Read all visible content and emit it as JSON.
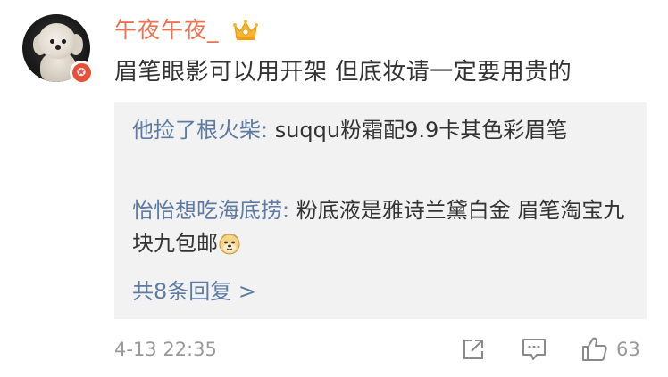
{
  "comment": {
    "username": "午夜午夜_",
    "text": "眉笔眼影可以用开架 但底妆请一定要用贵的",
    "vip_badge_glyph": "✪",
    "timestamp": "4-13 22:35",
    "like_count": "63"
  },
  "replies": [
    {
      "author": "他捡了根火柴",
      "separator": ": ",
      "text": "suqqu粉霜配9.9卡其色彩眉笔"
    },
    {
      "author": "怡怡想吃海底捞",
      "separator": ": ",
      "text": "粉底液是雅诗兰黛白金 眉笔淘宝九块九包邮"
    }
  ],
  "more_replies_label": "共8条回复 >",
  "icons": {
    "crown": "crown-icon",
    "share": "share-icon",
    "comment": "comment-icon",
    "like": "thumbs-up-icon",
    "emoji": "doge-emoji-icon"
  },
  "colors": {
    "username": "#eb7350",
    "link": "#5d7ba3",
    "text": "#333333",
    "muted": "#999999",
    "reply_bg": "#f2f2f2",
    "badge": "#e8503a"
  }
}
